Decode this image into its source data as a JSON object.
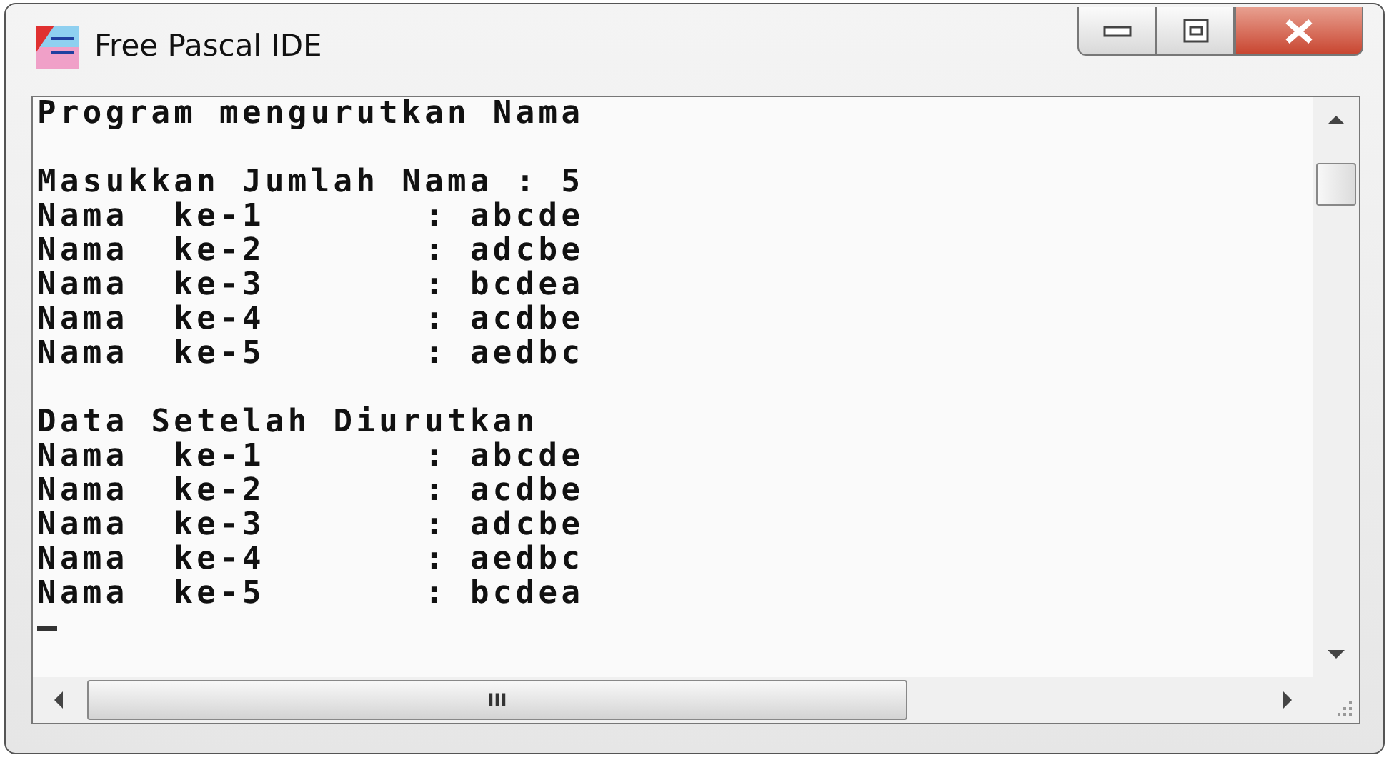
{
  "window": {
    "title": "Free Pascal IDE"
  },
  "console": {
    "sections": [
      {
        "lines": [
          "Program mengurutkan Nama"
        ]
      },
      {
        "lines": [
          "Masukkan Jumlah Nama : 5",
          "Nama  ke-1       : abcde",
          "Nama  ke-2       : adcbe",
          "Nama  ke-3       : bcdea",
          "Nama  ke-4       : acdbe",
          "Nama  ke-5       : aedbc"
        ]
      },
      {
        "lines": [
          "Data Setelah Diurutkan",
          "Nama  ke-1       : abcde",
          "Nama  ke-2       : acdbe",
          "Nama  ke-3       : adcbe",
          "Nama  ke-4       : aedbc",
          "Nama  ke-5       : bcdea"
        ]
      }
    ]
  },
  "scrollbars": {
    "horizontal_grip": "III"
  }
}
